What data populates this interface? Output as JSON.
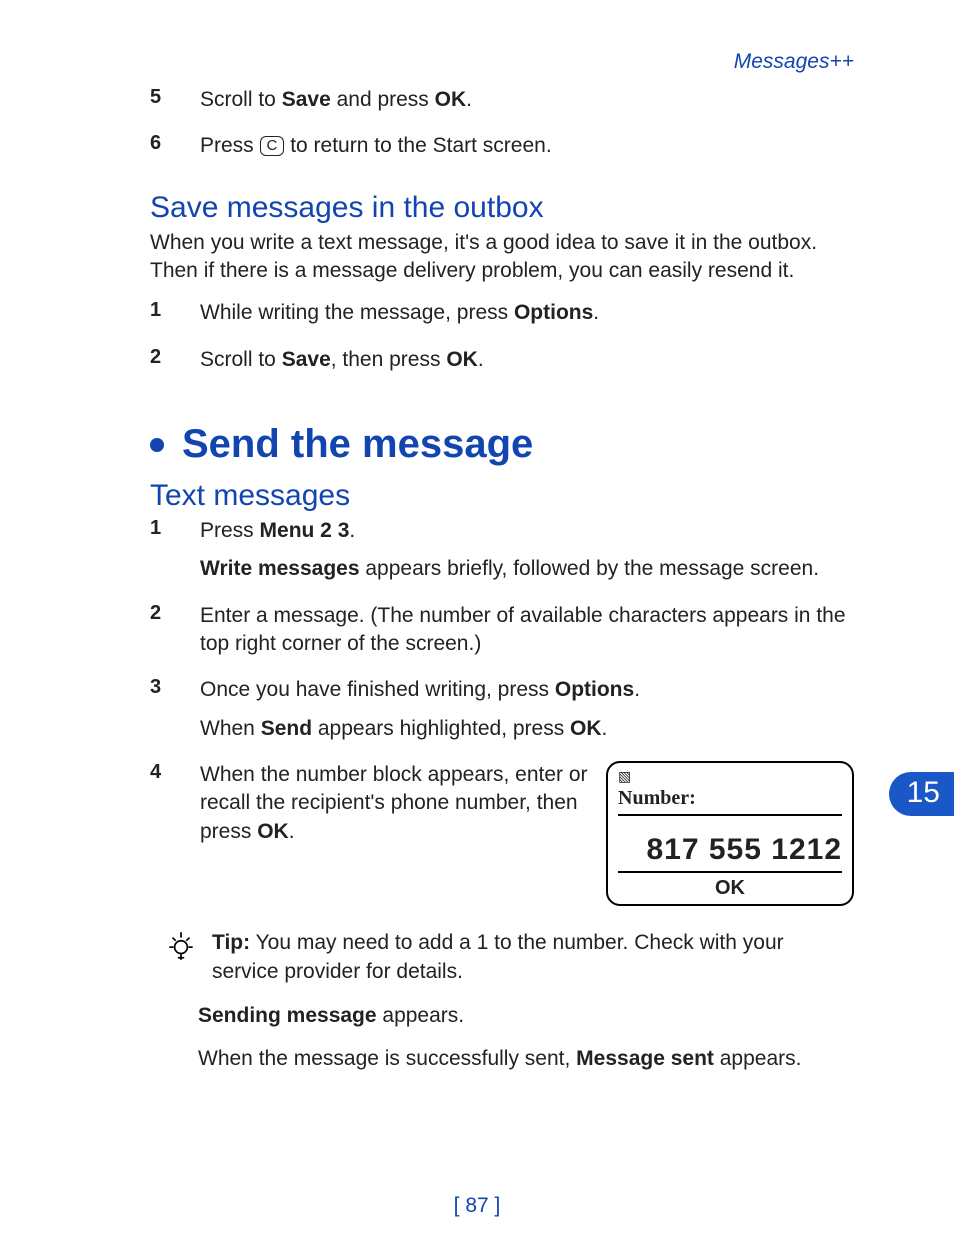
{
  "header": {
    "section_label": "Messages++"
  },
  "tab_number": "15",
  "page_number": "87",
  "cont_steps": {
    "5": {
      "pre": "Scroll to ",
      "b1": "Save",
      "mid": " and press ",
      "b2": "OK",
      "post": "."
    },
    "6": {
      "pre": "Press ",
      "key": "C",
      "post": " to return to the Start screen."
    }
  },
  "save_outbox": {
    "heading": "Save messages in the outbox",
    "intro": "When you write a text message, it's a good idea to save it in the outbox. Then if there is a message delivery problem, you can easily resend it.",
    "s1": {
      "pre": "While writing the message, press ",
      "b1": "Options",
      "post": "."
    },
    "s2": {
      "pre": "Scroll to ",
      "b1": "Save",
      "mid": ", then press ",
      "b2": "OK",
      "post": "."
    }
  },
  "send": {
    "heading": "Send the message",
    "sub": "Text messages",
    "s1": {
      "l1_pre": "Press ",
      "l1_b": "Menu 2 3",
      "l1_post": ".",
      "l2_b": "Write messages",
      "l2_post": " appears briefly, followed by the message screen."
    },
    "s2": "Enter a message. (The number of available characters appears in the top right corner of the screen.)",
    "s3": {
      "l1_pre": "Once you have finished writing, press ",
      "l1_b": "Options",
      "l1_post": ".",
      "l2_pre": "When ",
      "l2_b1": "Send",
      "l2_mid": " appears highlighted, press ",
      "l2_b2": "OK",
      "l2_post": "."
    },
    "s4": {
      "pre": "When the number block appears, enter or recall the recipient's phone number, then press ",
      "b": "OK",
      "post": "."
    }
  },
  "phone": {
    "label": "Number:",
    "value": "817 555 1212",
    "ok": "OK"
  },
  "tip": {
    "label": "Tip:",
    "text": " You may need to add a 1 to the number. Check with your service provider for details."
  },
  "after_tip": {
    "p1_b": "Sending message",
    "p1_post": " appears.",
    "p2_pre": "When the message is successfully sent, ",
    "p2_b": "Message sent",
    "p2_post": " appears."
  }
}
